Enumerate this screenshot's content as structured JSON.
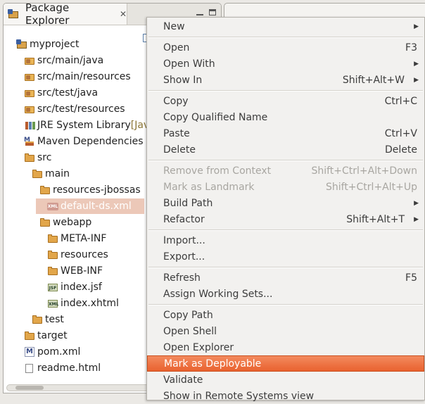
{
  "explorer": {
    "title": "Package Explorer",
    "tree": [
      {
        "label": "myproject",
        "twisty": "▼",
        "icon": "project-icon"
      },
      {
        "label": "src/main/java",
        "twisty": "▶",
        "icon": "source-folder-icon"
      },
      {
        "label": "src/main/resources",
        "twisty": "▶",
        "icon": "source-folder-icon"
      },
      {
        "label": "src/test/java",
        "twisty": "▶",
        "icon": "source-folder-icon"
      },
      {
        "label": "src/test/resources",
        "twisty": "▶",
        "icon": "source-folder-icon"
      },
      {
        "label": "JRE System Library",
        "decoration": "[Jav",
        "twisty": "▶",
        "icon": "library-icon"
      },
      {
        "label": "Maven Dependencies",
        "twisty": "▶",
        "icon": "maven-library-icon"
      },
      {
        "label": "src",
        "twisty": "▼",
        "icon": "folder-icon"
      },
      {
        "label": "main",
        "twisty": "▼",
        "icon": "folder-icon"
      },
      {
        "label": "resources-jbossas",
        "twisty": "▼",
        "icon": "folder-icon"
      },
      {
        "label": "default-ds.xml",
        "twisty": "",
        "icon": "xml-file-icon",
        "selected": true
      },
      {
        "label": "webapp",
        "twisty": "▼",
        "icon": "folder-icon"
      },
      {
        "label": "META-INF",
        "twisty": "▶",
        "icon": "folder-icon"
      },
      {
        "label": "resources",
        "twisty": "▶",
        "icon": "folder-icon"
      },
      {
        "label": "WEB-INF",
        "twisty": "▶",
        "icon": "folder-icon"
      },
      {
        "label": "index.jsf",
        "twisty": "",
        "icon": "jsf-file-icon"
      },
      {
        "label": "index.xhtml",
        "twisty": "",
        "icon": "xhtml-file-icon"
      },
      {
        "label": "test",
        "twisty": "▶",
        "icon": "folder-icon"
      },
      {
        "label": "target",
        "twisty": "",
        "icon": "folder-icon"
      },
      {
        "label": "pom.xml",
        "twisty": "",
        "icon": "pom-file-icon"
      },
      {
        "label": "readme.html",
        "twisty": "",
        "icon": "html-file-icon"
      }
    ]
  },
  "context_menu": {
    "items": [
      {
        "label": "New",
        "accel": "",
        "submenu": true
      },
      {
        "separator": true
      },
      {
        "label": "Open",
        "accel": "F3"
      },
      {
        "label": "Open With",
        "accel": "",
        "submenu": true
      },
      {
        "label": "Show In",
        "accel": "Shift+Alt+W",
        "submenu": true
      },
      {
        "separator": true
      },
      {
        "label": "Copy",
        "accel": "Ctrl+C"
      },
      {
        "label": "Copy Qualified Name",
        "accel": ""
      },
      {
        "label": "Paste",
        "accel": "Ctrl+V"
      },
      {
        "label": "Delete",
        "accel": "Delete"
      },
      {
        "separator": true
      },
      {
        "label": "Remove from Context",
        "accel": "Shift+Ctrl+Alt+Down",
        "disabled": true
      },
      {
        "label": "Mark as Landmark",
        "accel": "Shift+Ctrl+Alt+Up",
        "disabled": true
      },
      {
        "label": "Build Path",
        "accel": "",
        "submenu": true
      },
      {
        "label": "Refactor",
        "accel": "Shift+Alt+T",
        "submenu": true
      },
      {
        "separator": true
      },
      {
        "label": "Import...",
        "accel": ""
      },
      {
        "label": "Export...",
        "accel": ""
      },
      {
        "separator": true
      },
      {
        "label": "Refresh",
        "accel": "F5"
      },
      {
        "label": "Assign Working Sets...",
        "accel": ""
      },
      {
        "separator": true
      },
      {
        "label": "Copy Path",
        "accel": ""
      },
      {
        "label": "Open Shell",
        "accel": ""
      },
      {
        "label": "Open Explorer",
        "accel": ""
      },
      {
        "label": "Mark as Deployable",
        "accel": "",
        "highlighted": true
      },
      {
        "label": "Validate",
        "accel": ""
      },
      {
        "label": "Show in Remote Systems view",
        "accel": ""
      }
    ]
  },
  "colors": {
    "menu_highlight": "#e9622f",
    "selection": "#ecc8b8"
  }
}
